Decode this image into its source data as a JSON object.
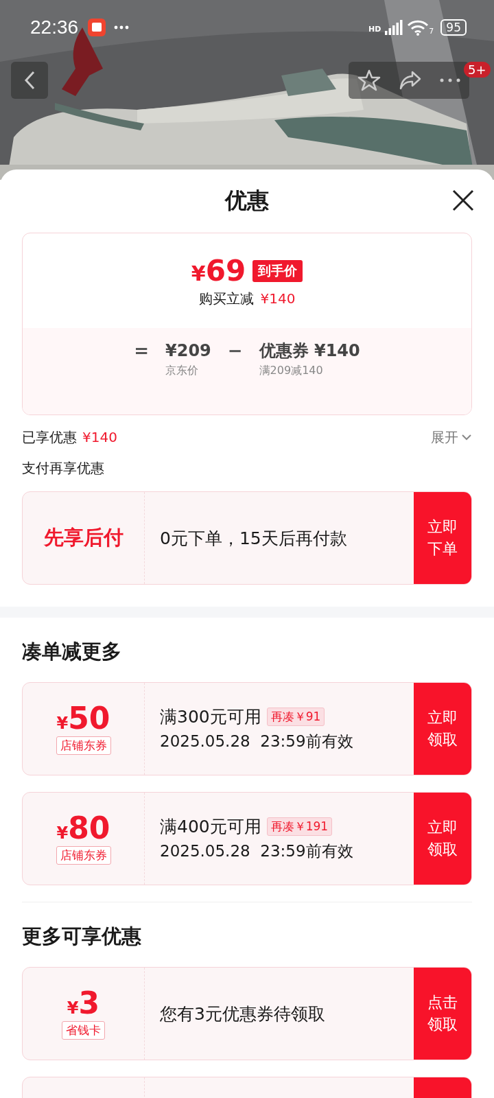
{
  "status_bar": {
    "time": "22:36",
    "network_label": "HD",
    "wifi_badge": "7",
    "battery": "95"
  },
  "top_bar": {
    "badge": "5+"
  },
  "sheet": {
    "title": "优惠"
  },
  "price_card": {
    "final_price": {
      "currency": "¥",
      "value": "69"
    },
    "price_tag": "到手价",
    "saving_label": "购买立减",
    "saving_amount": "¥140",
    "breakdown": [
      {
        "kind": "operator",
        "text": "="
      },
      {
        "kind": "term",
        "value": "¥209",
        "caption": "京东价"
      },
      {
        "kind": "operator",
        "text": "−"
      },
      {
        "kind": "term",
        "value": "优惠券 ¥140",
        "caption": "满209减140"
      }
    ]
  },
  "summary": {
    "label": "已享优惠",
    "amount": "¥140",
    "toggle": "展开"
  },
  "pay_section": {
    "title": "支付再享优惠",
    "card": {
      "headline": "先享后付",
      "text": "0元下单，15天后再付款",
      "button": "立即下单"
    }
  },
  "sections": [
    {
      "title": "凑单减更多",
      "coupons": [
        {
          "kind": "threshold",
          "currency": "¥",
          "value": "50",
          "tag": "店铺东券",
          "condition": "满300元可用",
          "hint": "再凑￥91",
          "validity": "2025.05.28  23:59前有效",
          "button": "立即领取"
        },
        {
          "kind": "threshold",
          "currency": "¥",
          "value": "80",
          "tag": "店铺东券",
          "condition": "满400元可用",
          "hint": "再凑￥191",
          "validity": "2025.05.28  23:59前有效",
          "button": "立即领取"
        }
      ]
    },
    {
      "title": "更多可享优惠",
      "coupons": [
        {
          "kind": "plain",
          "currency": "¥",
          "value": "3",
          "tag": "省钱卡",
          "text": "您有3元优惠券待领取",
          "button": "点击领取"
        },
        {
          "kind": "cut"
        }
      ]
    }
  ]
}
